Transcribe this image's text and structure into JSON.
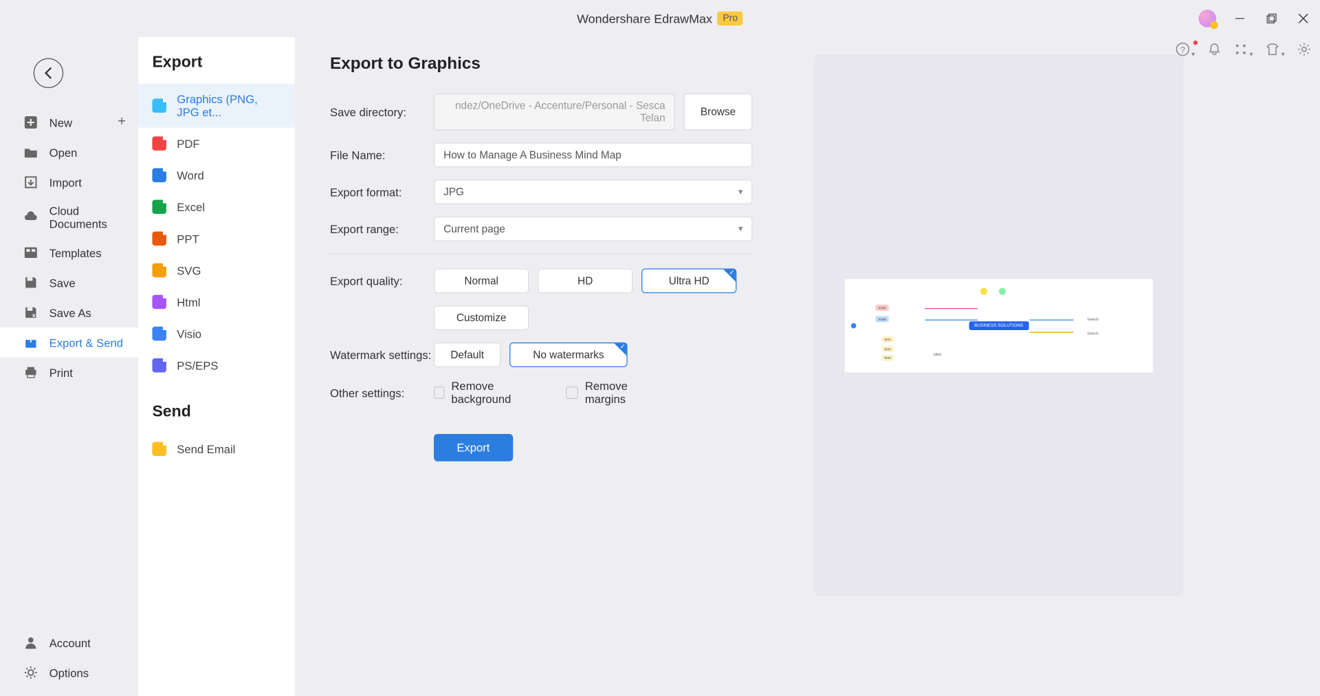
{
  "titlebar": {
    "title": "Wondershare EdrawMax",
    "pro": "Pro"
  },
  "sidebar1": {
    "items": [
      {
        "label": "New",
        "icon": "plus-box",
        "extra": "plus"
      },
      {
        "label": "Open",
        "icon": "folder"
      },
      {
        "label": "Import",
        "icon": "import"
      },
      {
        "label": "Cloud Documents",
        "icon": "cloud"
      },
      {
        "label": "Templates",
        "icon": "template"
      },
      {
        "label": "Save",
        "icon": "save"
      },
      {
        "label": "Save As",
        "icon": "saveas"
      },
      {
        "label": "Export & Send",
        "icon": "export",
        "active": true
      },
      {
        "label": "Print",
        "icon": "print"
      }
    ],
    "bottom": [
      {
        "label": "Account",
        "icon": "account"
      },
      {
        "label": "Options",
        "icon": "gear"
      }
    ]
  },
  "sidebar2": {
    "export_heading": "Export",
    "send_heading": "Send",
    "formats": [
      {
        "label": "Graphics (PNG, JPG et...",
        "color": "#38bdf8",
        "active": true
      },
      {
        "label": "PDF",
        "color": "#ef4444"
      },
      {
        "label": "Word",
        "color": "#2b7de0"
      },
      {
        "label": "Excel",
        "color": "#16a34a"
      },
      {
        "label": "PPT",
        "color": "#ea580c"
      },
      {
        "label": "SVG",
        "color": "#f59e0b"
      },
      {
        "label": "Html",
        "color": "#a855f7"
      },
      {
        "label": "Visio",
        "color": "#3b82f6"
      },
      {
        "label": "PS/EPS",
        "color": "#6366f1"
      }
    ],
    "send_items": [
      {
        "label": "Send Email",
        "color": "#fbbf24"
      }
    ]
  },
  "form": {
    "heading": "Export to Graphics",
    "save_dir_label": "Save directory:",
    "save_dir": "ndez/OneDrive - Accenture/Personal - Sesca Telan",
    "browse": "Browse",
    "filename_label": "File Name:",
    "filename": "How to Manage A Business Mind Map",
    "format_label": "Export format:",
    "format": "JPG",
    "range_label": "Export range:",
    "range": "Current page",
    "quality_label": "Export quality:",
    "quality": [
      "Normal",
      "HD",
      "Ultra HD"
    ],
    "quality_selected": "Ultra HD",
    "customize": "Customize",
    "watermark_label": "Watermark settings:",
    "watermark": [
      "Default",
      "No watermarks"
    ],
    "watermark_selected": "No watermarks",
    "other_label": "Other settings:",
    "remove_bg": "Remove background",
    "remove_margins": "Remove margins",
    "export_btn": "Export"
  },
  "preview": {
    "center": "BUSINESS SOLUTIONS"
  }
}
